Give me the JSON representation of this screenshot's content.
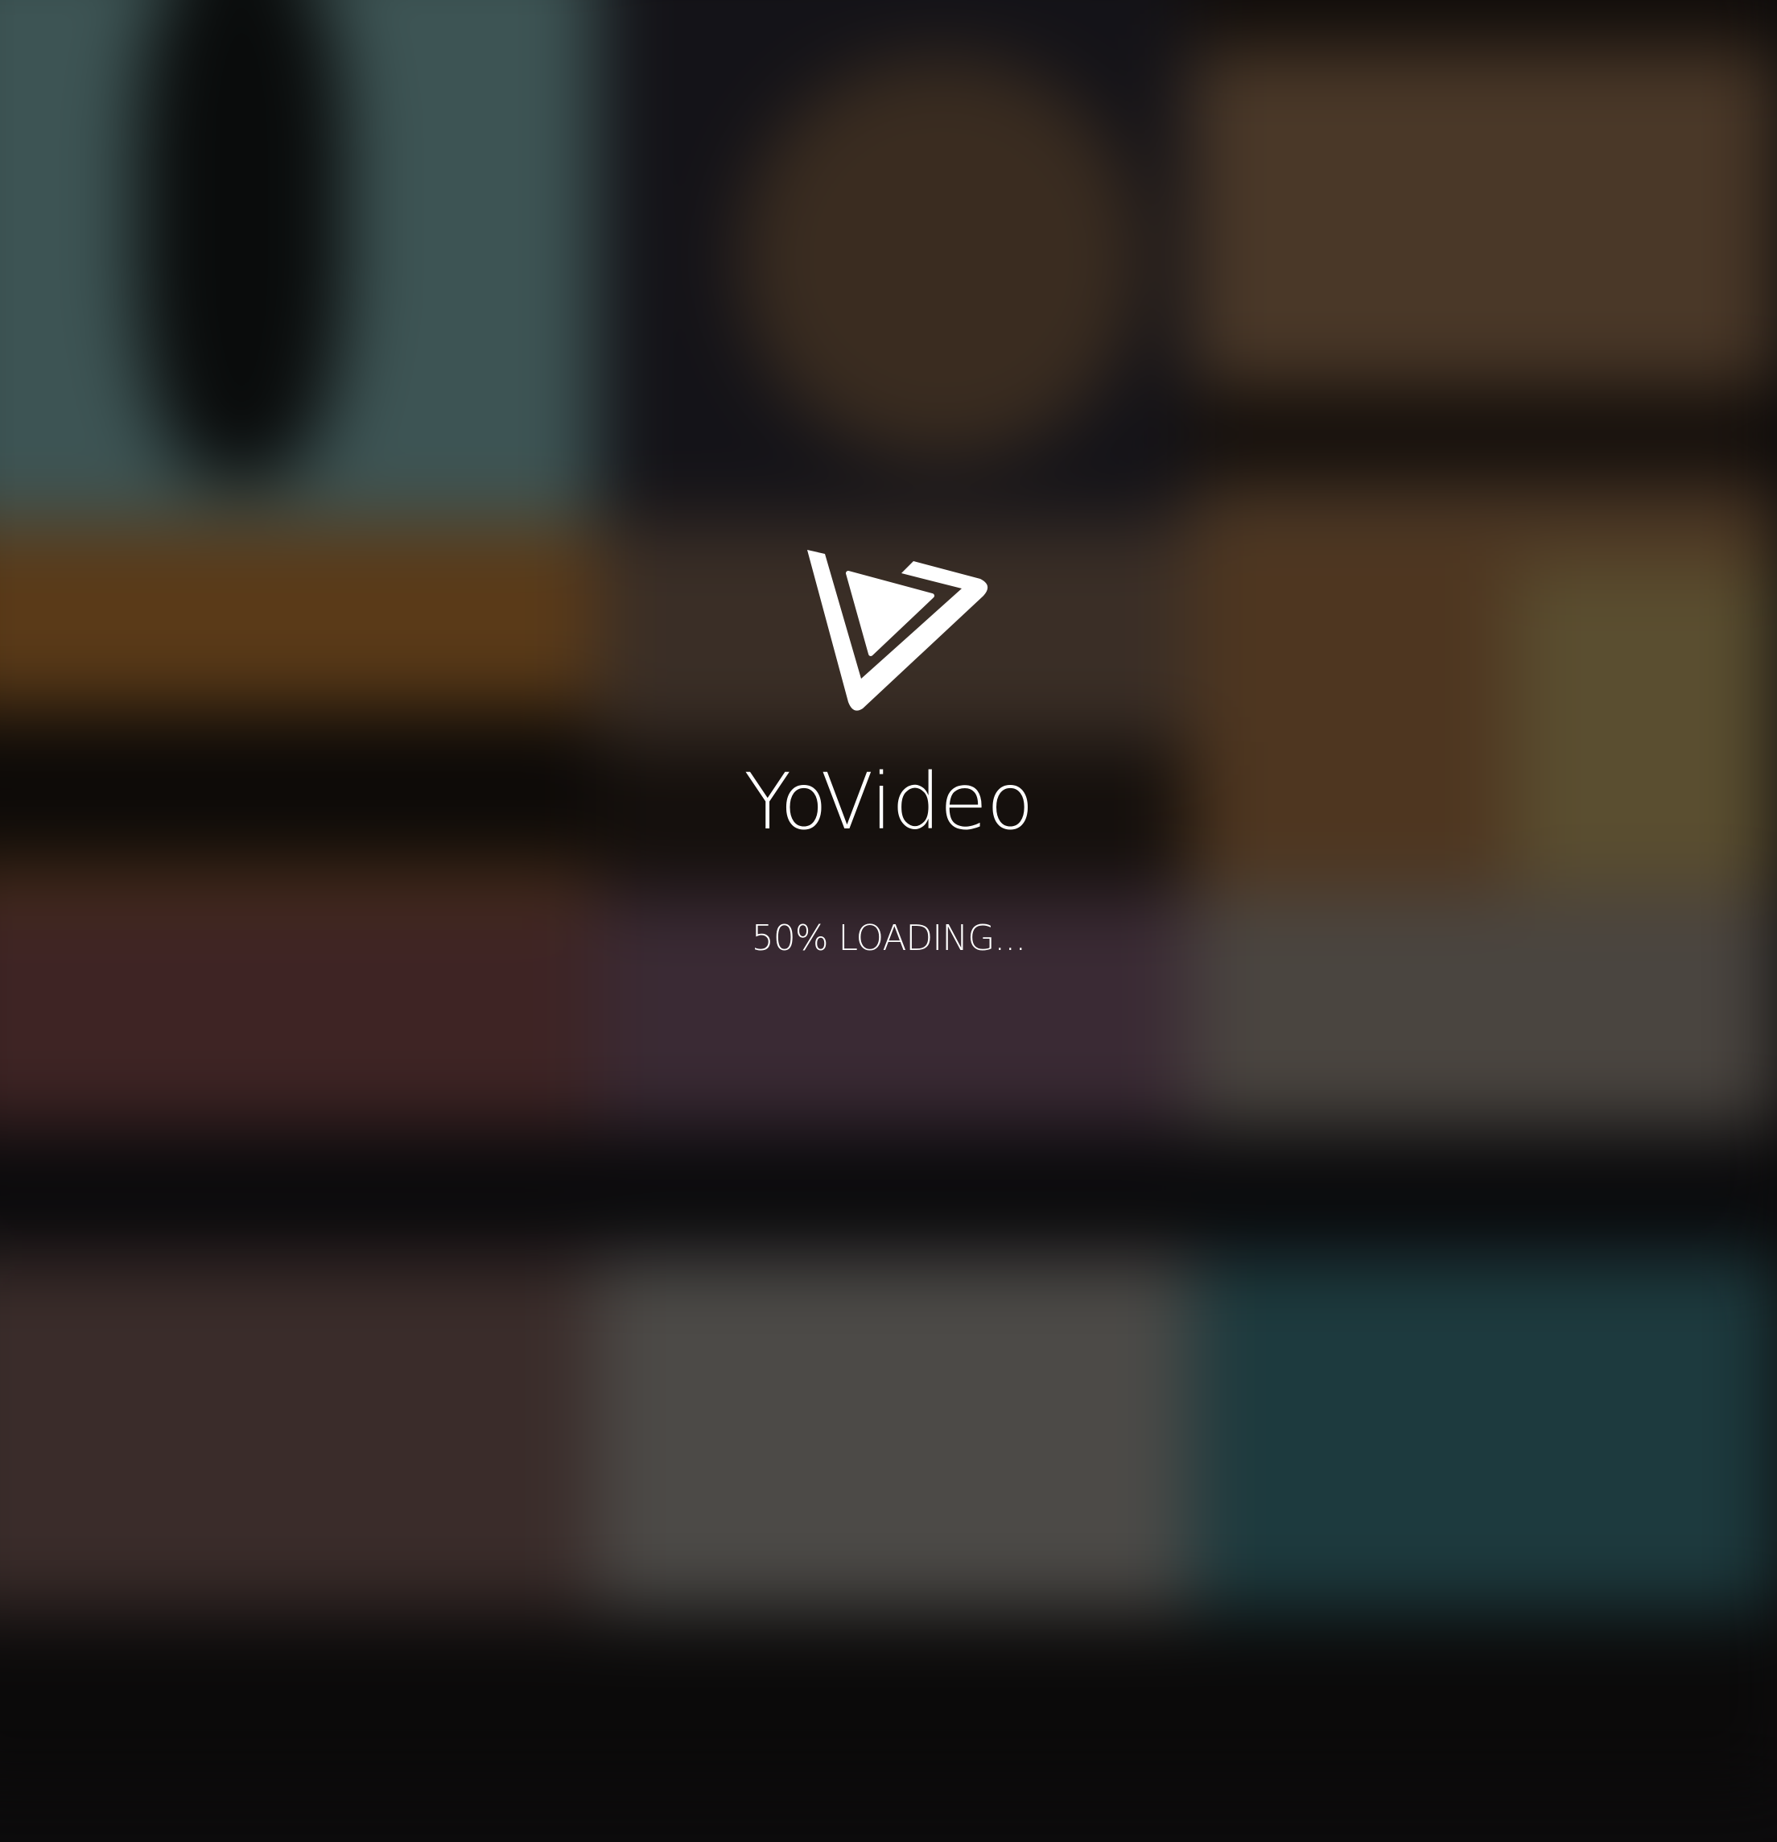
{
  "app": {
    "name": "YoVideo",
    "logo_icon": "play-triangle-logo-icon"
  },
  "loading": {
    "progress_percent": 50,
    "text": "50% LOADING..."
  },
  "colors": {
    "text": "#ffffff",
    "logo": "#ffffff"
  }
}
